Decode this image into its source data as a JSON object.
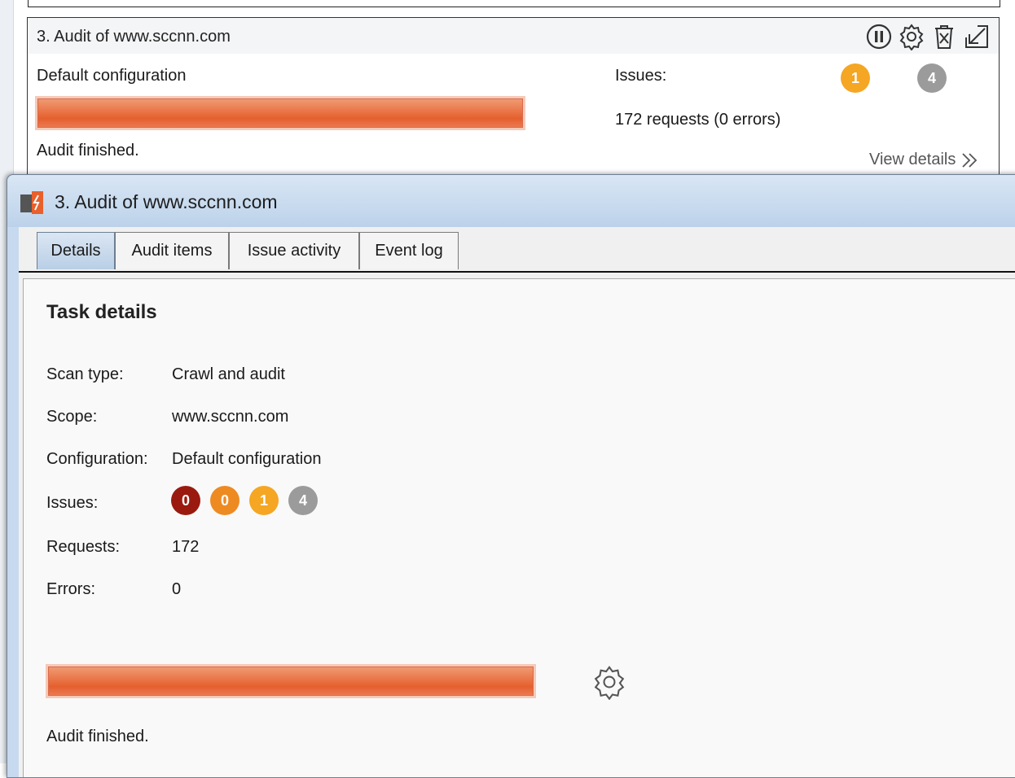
{
  "task_card": {
    "title": "3. Audit of www.sccnn.com",
    "configuration": "Default configuration",
    "progress": 1.0,
    "status": "Audit finished.",
    "issues_label": "Issues:",
    "issue_counts": [
      "1",
      "4"
    ],
    "requests": "172 requests (0 errors)",
    "view_details": "View details",
    "icons": [
      "pause-icon",
      "gear-icon",
      "delete-icon",
      "collapse-icon"
    ]
  },
  "window": {
    "title": "3. Audit of www.sccnn.com",
    "tabs": [
      {
        "label": "Details",
        "active": true
      },
      {
        "label": "Audit items",
        "active": false
      },
      {
        "label": "Issue activity",
        "active": false
      },
      {
        "label": "Event log",
        "active": false
      }
    ]
  },
  "details": {
    "heading": "Task details",
    "scan_type_label": "Scan type:",
    "scan_type": "Crawl and audit",
    "scope_label": "Scope:",
    "scope": "www.sccnn.com",
    "configuration_label": "Configuration:",
    "configuration": "Default configuration",
    "issues_label": "Issues:",
    "issues": [
      "0",
      "0",
      "1",
      "4"
    ],
    "requests_label": "Requests:",
    "requests": "172",
    "errors_label": "Errors:",
    "errors": "0",
    "progress": 1.0,
    "status": "Audit finished."
  },
  "colors": {
    "high": "#9a1a10",
    "medium": "#ee8a22",
    "low": "#f5a623",
    "info": "#9b9b9b",
    "progress": "#e55f2e"
  }
}
